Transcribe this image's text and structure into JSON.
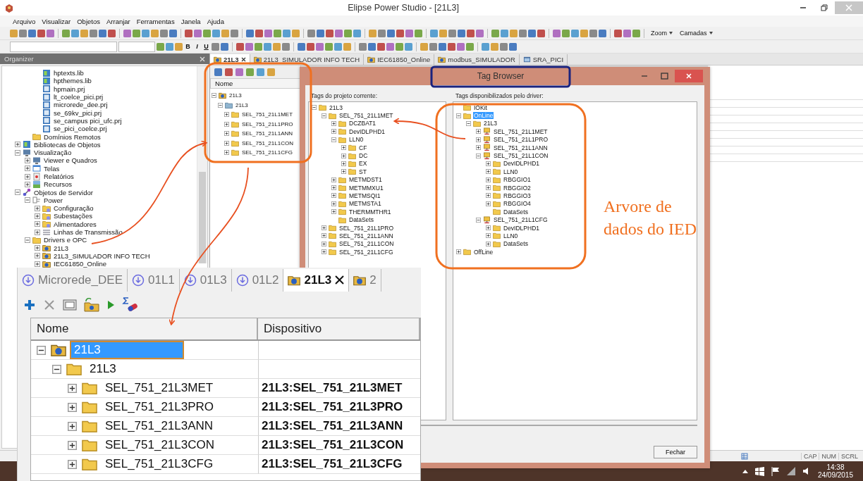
{
  "window": {
    "title": "Elipse Power Studio - [21L3]"
  },
  "menu": [
    "Arquivo",
    "Visualizar",
    "Objetos",
    "Arranjar",
    "Ferramentas",
    "Janela",
    "Ajuda"
  ],
  "toolbar": {
    "dropdowns": [
      "Zoom",
      "Camadas"
    ],
    "format_buttons": [
      "B",
      "I",
      "U"
    ]
  },
  "organizer": {
    "title": "Organizer",
    "continued_files": [
      {
        "label": "hptexts.lib",
        "kind": "lib"
      },
      {
        "label": "hpthemes.lib",
        "kind": "lib"
      },
      {
        "label": "hpmain.prj",
        "kind": "prj"
      },
      {
        "label": "lt_coelce_pici.prj",
        "kind": "prj"
      },
      {
        "label": "microrede_dee.prj",
        "kind": "prj"
      },
      {
        "label": "se_69kv_pici.prj",
        "kind": "prj"
      },
      {
        "label": "se_campus pici_ufc.prj",
        "kind": "prj"
      },
      {
        "label": "se_pici_coelce.prj",
        "kind": "prj"
      }
    ],
    "continued_folder": {
      "label": "Domínios Remotos",
      "kind": "folder"
    },
    "tree": [
      {
        "label": "Bibliotecas de Objetos",
        "kind": "lib",
        "expanded": false
      },
      {
        "label": "Visualização",
        "kind": "monitor",
        "expanded": true,
        "children": [
          {
            "label": "Viewer e Quadros",
            "kind": "monitor",
            "expanded": false
          },
          {
            "label": "Telas",
            "kind": "window",
            "expanded": false
          },
          {
            "label": "Relatórios",
            "kind": "report",
            "expanded": false
          },
          {
            "label": "Recursos",
            "kind": "image",
            "expanded": false
          }
        ]
      },
      {
        "label": "Objetos de Servidor",
        "kind": "nodes",
        "expanded": true,
        "children": [
          {
            "label": "Power",
            "kind": "plug",
            "expanded": true,
            "children": [
              {
                "label": "Configuração",
                "kind": "folder-badge",
                "expanded": false
              },
              {
                "label": "Subestações",
                "kind": "folder-badge",
                "expanded": false
              },
              {
                "label": "Alimentadores",
                "kind": "folder-badge",
                "expanded": false
              },
              {
                "label": "Linhas de Transmissão",
                "kind": "line",
                "expanded": false
              }
            ]
          },
          {
            "label": "Drivers e OPC",
            "kind": "folder",
            "expanded": true,
            "children": [
              {
                "label": "21L3",
                "kind": "driver",
                "expanded": false
              },
              {
                "label": "21L3_SIMULADOR INFO TECH",
                "kind": "driver",
                "expanded": false
              },
              {
                "label": "IEC61850_Online",
                "kind": "driver",
                "expanded": false
              }
            ]
          }
        ]
      }
    ]
  },
  "document_tabs": [
    {
      "label": "21L3",
      "kind": "driver",
      "selected": true
    },
    {
      "label": "21L3_SIMULADOR INFO TECH",
      "kind": "driver",
      "selected": false
    },
    {
      "label": "IEC61850_Online",
      "kind": "driver",
      "selected": false
    },
    {
      "label": "modbus_SIMULADOR",
      "kind": "driver",
      "selected": false
    },
    {
      "label": "SRA_PICI",
      "kind": "screen",
      "selected": false
    }
  ],
  "driver_panel": {
    "column": "Nome",
    "tree": [
      {
        "label": "21L3",
        "kind": "driver",
        "expanded": true,
        "children": [
          {
            "label": "21L3",
            "kind": "folder-blue",
            "expanded": true,
            "children": [
              {
                "label": "SEL_751_21L1MET",
                "kind": "folder",
                "expanded": false
              },
              {
                "label": "SEL_751_21L1PRO",
                "kind": "folder",
                "expanded": false
              },
              {
                "label": "SEL_751_21L1ANN",
                "kind": "folder",
                "expanded": false
              },
              {
                "label": "SEL_751_21L1CON",
                "kind": "folder",
                "expanded": false
              },
              {
                "label": "SEL_751_21L1CFG",
                "kind": "folder",
                "expanded": false
              }
            ]
          }
        ]
      }
    ]
  },
  "tag_browser": {
    "title": "Tag Browser",
    "left_label": "Tags do projeto corrente:",
    "right_label": "Tags disponibilizados pelo driver:",
    "close_button": "Fechar",
    "left_tree": [
      {
        "label": "21L3",
        "kind": "folder",
        "expanded": true,
        "children": [
          {
            "label": "SEL_751_21L1MET",
            "kind": "folder",
            "expanded": true,
            "children": [
              {
                "label": "DCZBAT1",
                "kind": "folder",
                "expanded": false
              },
              {
                "label": "DevIDLPHD1",
                "kind": "folder",
                "expanded": false
              },
              {
                "label": "LLN0",
                "kind": "folder",
                "expanded": true,
                "children": [
                  {
                    "label": "CF",
                    "kind": "folder",
                    "expanded": false
                  },
                  {
                    "label": "DC",
                    "kind": "folder",
                    "expanded": false
                  },
                  {
                    "label": "EX",
                    "kind": "folder",
                    "expanded": false
                  },
                  {
                    "label": "ST",
                    "kind": "folder",
                    "expanded": false
                  }
                ]
              },
              {
                "label": "METMDST1",
                "kind": "folder",
                "expanded": false
              },
              {
                "label": "METMMXU1",
                "kind": "folder",
                "expanded": false
              },
              {
                "label": "METMSQI1",
                "kind": "folder",
                "expanded": false
              },
              {
                "label": "METMSTA1",
                "kind": "folder",
                "expanded": false
              },
              {
                "label": "THERMMTHR1",
                "kind": "folder",
                "expanded": false
              },
              {
                "label": "DataSets",
                "kind": "folder"
              }
            ]
          },
          {
            "label": "SEL_751_21L1PRO",
            "kind": "folder",
            "expanded": false
          },
          {
            "label": "SEL_751_21L1ANN",
            "kind": "folder",
            "expanded": false
          },
          {
            "label": "SEL_751_21L1CON",
            "kind": "folder",
            "expanded": false
          },
          {
            "label": "SEL_751_21L1CFG",
            "kind": "folder",
            "expanded": false
          }
        ]
      }
    ],
    "right_tree": [
      {
        "label": "IOKit",
        "kind": "folder",
        "selected": false
      },
      {
        "label": "OnLine",
        "kind": "folder",
        "expanded": true,
        "selected": true,
        "children": [
          {
            "label": "21L3",
            "kind": "folder",
            "expanded": true,
            "selected": false,
            "children": [
              {
                "label": "SEL_751_21L1MET",
                "kind": "ied",
                "expanded": false,
                "selected": false
              },
              {
                "label": "SEL_751_21L1PRO",
                "kind": "ied",
                "expanded": false,
                "selected": false
              },
              {
                "label": "SEL_751_21L1ANN",
                "kind": "ied",
                "expanded": false,
                "selected": false
              },
              {
                "label": "SEL_751_21L1CON",
                "kind": "ied",
                "expanded": true,
                "selected": false,
                "children": [
                  {
                    "label": "DevIDLPHD1",
                    "kind": "folder",
                    "expanded": false,
                    "selected": false
                  },
                  {
                    "label": "LLN0",
                    "kind": "folder",
                    "expanded": false,
                    "selected": false
                  },
                  {
                    "label": "RBGGIO1",
                    "kind": "folder",
                    "expanded": false,
                    "selected": false
                  },
                  {
                    "label": "RBGGIO2",
                    "kind": "folder",
                    "expanded": false,
                    "selected": false
                  },
                  {
                    "label": "RBGGIO3",
                    "kind": "folder",
                    "expanded": false,
                    "selected": false
                  },
                  {
                    "label": "RBGGIO4",
                    "kind": "folder",
                    "expanded": false,
                    "selected": false
                  },
                  {
                    "label": "DataSets",
                    "kind": "folder",
                    "selected": false
                  }
                ]
              },
              {
                "label": "SEL_751_21L1CFG",
                "kind": "ied",
                "expanded": true,
                "selected": false,
                "children": [
                  {
                    "label": "DevIDLPHD1",
                    "kind": "folder",
                    "expanded": false,
                    "selected": false
                  },
                  {
                    "label": "LLN0",
                    "kind": "folder",
                    "expanded": false,
                    "selected": false
                  },
                  {
                    "label": "DataSets",
                    "kind": "folder",
                    "expanded": false,
                    "selected": false
                  }
                ]
              }
            ]
          }
        ]
      },
      {
        "label": "OffLine",
        "kind": "folder",
        "expanded": false,
        "selected": false
      }
    ]
  },
  "annotation": {
    "lines": [
      "Arvore de",
      "dados do IED"
    ]
  },
  "inset": {
    "tabs": [
      {
        "label": "Microrede_DEE",
        "kind": "circle-arrow",
        "selected": false
      },
      {
        "label": "01L1",
        "kind": "circle-arrow",
        "selected": false
      },
      {
        "label": "01L3",
        "kind": "circle-arrow",
        "selected": false
      },
      {
        "label": "01L2",
        "kind": "circle-arrow",
        "selected": false
      },
      {
        "label": "21L3",
        "kind": "driver",
        "selected": true
      },
      {
        "label": "2",
        "kind": "driver",
        "selected": false
      }
    ],
    "columns": [
      "Nome",
      "Dispositivo"
    ],
    "rows": [
      {
        "name": "21L3",
        "kind": "driver",
        "expanded": true,
        "selected": true,
        "children": [
          {
            "name": "21L3",
            "kind": "folder",
            "expanded": true,
            "selected": false,
            "children": [
              {
                "name": "SEL_751_21L3MET",
                "device": "21L3:SEL_751_21L3MET",
                "kind": "folder",
                "expanded": false,
                "selected": false
              },
              {
                "name": "SEL_751_21L3PRO",
                "device": "21L3:SEL_751_21L3PRO",
                "kind": "folder",
                "expanded": false,
                "selected": false
              },
              {
                "name": "SEL_751_21L3ANN",
                "device": "21L3:SEL_751_21L3ANN",
                "kind": "folder",
                "expanded": false,
                "selected": false
              },
              {
                "name": "SEL_751_21L3CON",
                "device": "21L3:SEL_751_21L3CON",
                "kind": "folder",
                "expanded": false,
                "selected": false
              },
              {
                "name": "SEL_751_21L3CFG",
                "device": "21L3:SEL_751_21L3CFG",
                "kind": "folder",
                "expanded": false,
                "selected": false
              }
            ]
          }
        ]
      }
    ]
  },
  "status_bar": {
    "indicators": [
      "CAP",
      "NUM",
      "SCRL"
    ]
  },
  "taskbar": {
    "time": "14:38",
    "date": "24/09/2015"
  }
}
